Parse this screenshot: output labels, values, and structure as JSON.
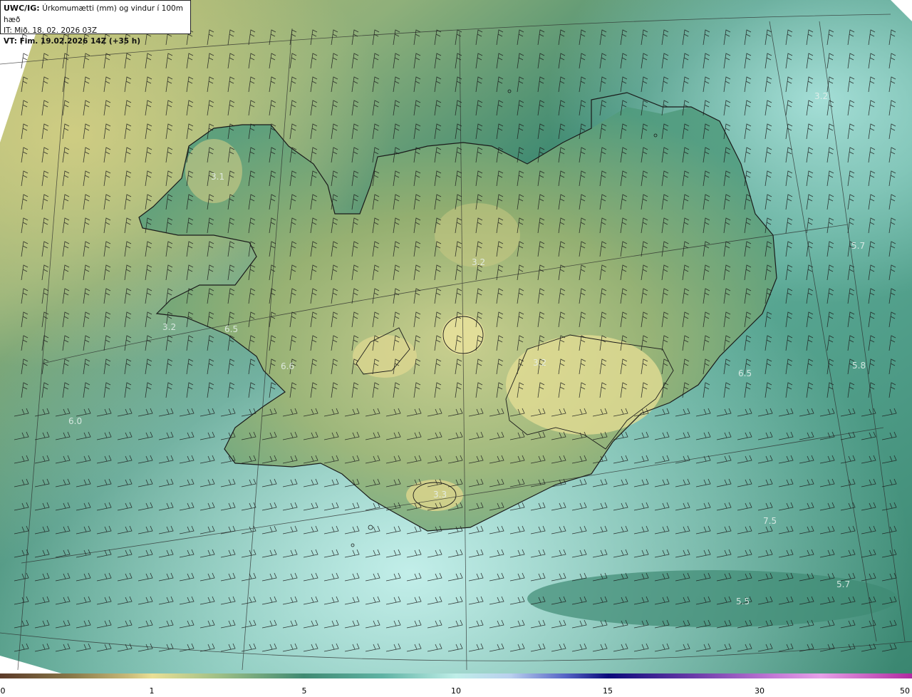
{
  "header": {
    "product": "UWC/IG:",
    "title": "Úrkomumætti (mm) og vindur í 100m hæð",
    "init_label": "IT:",
    "init_time": "Mið. 18. 02. 2026 03Z",
    "valid_label": "VT:",
    "valid_time": "Fim. 19.02.2026 14Z (+35 h)"
  },
  "map_labels": [
    "3.1",
    "3.2",
    "3.2",
    "6.5",
    "6.6",
    "6.0",
    "3.2",
    "3.2",
    "3.3",
    "5.7",
    "6.5",
    "5.8",
    "7.5",
    "5.7",
    "5.5"
  ],
  "colorbar": {
    "ticks": [
      "0",
      "1",
      "5",
      "10",
      "15",
      "30",
      "50"
    ]
  },
  "colors": {
    "ocean_teal": "#3f8a72",
    "light_aqua": "#bfeee8",
    "yellow_land": "#e9df95",
    "olive": "#9fb36f",
    "coastline": "#1a1a1a",
    "barb": "#1a1a1a"
  }
}
